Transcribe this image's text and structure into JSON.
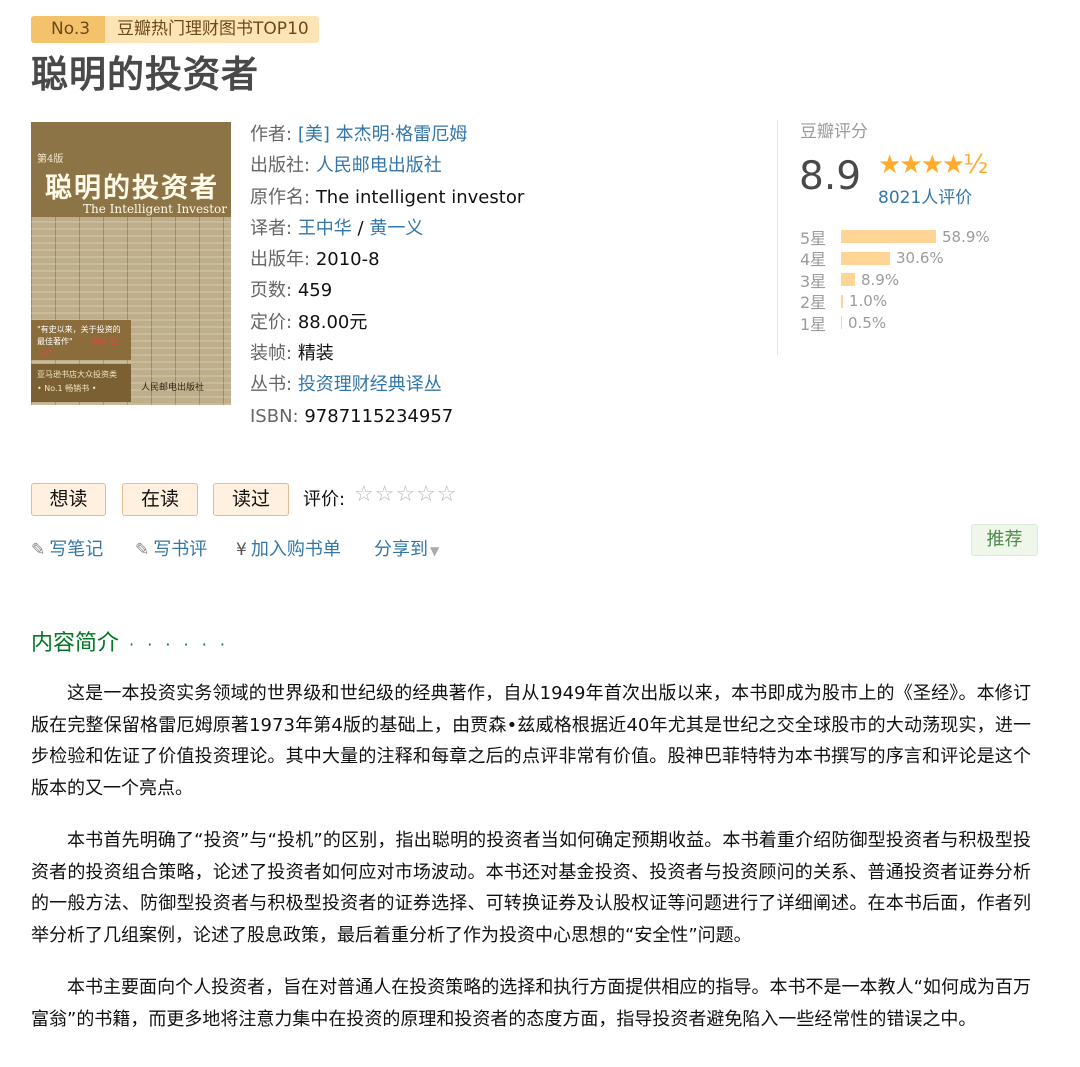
{
  "badge": {
    "rank": "No.3",
    "list": "豆瓣热门理财图书TOP10"
  },
  "book": {
    "title": "聪明的投资者",
    "cover": {
      "edition": "第4版",
      "title": "聪明的投资者",
      "subtitle": "The Intelligent Investor",
      "quote": "\"有史以来，关于投资的最佳著作\"",
      "quote_by": "——沃伦·巴菲特",
      "seller_line1": "亚马逊书店大众投资类",
      "seller_line2": "• No.1 畅销书 •",
      "publisher": "人民邮电出版社"
    }
  },
  "info": {
    "author_label": "作者:",
    "author": "[美] 本杰明·格雷厄姆",
    "publisher_label": "出版社:",
    "publisher": "人民邮电出版社",
    "original_label": "原作名:",
    "original": "The intelligent investor",
    "translator_label": "译者:",
    "translator1": "王中华",
    "translator_sep": " / ",
    "translator2": "黄一义",
    "year_label": "出版年:",
    "year": "2010-8",
    "pages_label": "页数:",
    "pages": "459",
    "price_label": "定价:",
    "price": "88.00元",
    "binding_label": "装帧:",
    "binding": "精装",
    "series_label": "丛书:",
    "series": "投资理财经典译丛",
    "isbn_label": "ISBN:",
    "isbn": "9787115234957"
  },
  "rating": {
    "label": "豆瓣评分",
    "score": "8.9",
    "stars": "★★★★½",
    "stars_value": 4.5,
    "count": "8021人评价",
    "histogram": [
      {
        "label": "5星",
        "pct": "58.9%",
        "value": 58.9
      },
      {
        "label": "4星",
        "pct": "30.6%",
        "value": 30.6
      },
      {
        "label": "3星",
        "pct": "8.9%",
        "value": 8.9
      },
      {
        "label": "2星",
        "pct": "1.0%",
        "value": 1.0
      },
      {
        "label": "1星",
        "pct": "0.5%",
        "value": 0.5
      }
    ]
  },
  "actions": {
    "want": "想读",
    "reading": "在读",
    "read": "读过",
    "rate_label": "评价:",
    "rate_stars": "☆☆☆☆☆"
  },
  "links": {
    "note": "写笔记",
    "review": "写书评",
    "cart": "加入购书单",
    "share": "分享到",
    "recommend": "推荐"
  },
  "intro": {
    "heading": "内容简介",
    "dots": "· · · · · ·",
    "paragraphs": [
      "这是一本投资实务领域的世界级和世纪级的经典著作，自从1949年首次出版以来，本书即成为股市上的《圣经》。本修订版在完整保留格雷厄姆原著1973年第4版的基础上，由贾森•兹威格根据近40年尤其是世纪之交全球股市的大动荡现实，进一步检验和佐证了价值投资理论。其中大量的注释和每章之后的点评非常有价值。股神巴菲特特为本书撰写的序言和评论是这个版本的又一个亮点。",
      "本书首先明确了“投资”与“投机”的区别，指出聪明的投资者当如何确定预期收益。本书着重介绍防御型投资者与积极型投资者的投资组合策略，论述了投资者如何应对市场波动。本书还对基金投资、投资者与投资顾问的关系、普通投资者证券分析的一般方法、防御型投资者与积极型投资者的证券选择、可转换证券及认股权证等问题进行了详细阐述。在本书后面，作者列举分析了几组案例，论述了股息政策，最后着重分析了作为投资中心思想的“安全性”问题。",
      "本书主要面向个人投资者，旨在对普通人在投资策略的选择和执行方面提供相应的指导。本书不是一本教人“如何成为百万富翁”的书籍，而更多地将注意力集中在投资的原理和投资者的态度方面，指导投资者避免陷入一些经常性的错误之中。"
    ]
  }
}
